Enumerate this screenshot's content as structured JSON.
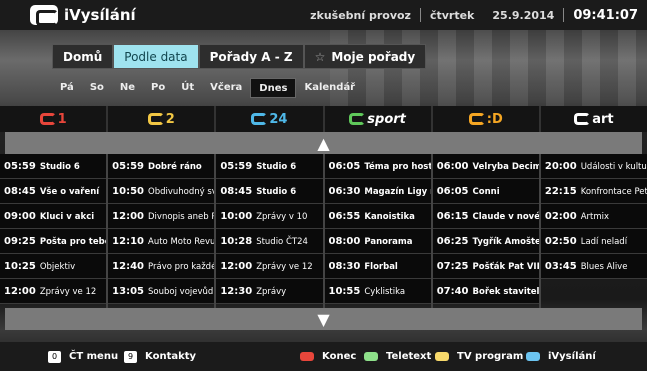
{
  "header": {
    "app_title": "iVysílání",
    "mode": "zkušební provoz",
    "weekday": "čtvrtek",
    "date": "25.9.2014",
    "time": "09:41:07"
  },
  "nav": {
    "tabs": [
      "Domů",
      "Podle data",
      "Pořady A - Z",
      "Moje pořady"
    ],
    "active_tab": "Podle data"
  },
  "days": {
    "items": [
      "Pá",
      "So",
      "Ne",
      "Po",
      "Út",
      "Včera",
      "Dnes",
      "Kalendář"
    ],
    "active": "Dnes"
  },
  "channels": [
    {
      "name": "1",
      "color": "#e8463b"
    },
    {
      "name": "2",
      "color": "#f2c744"
    },
    {
      "name": "24",
      "color": "#4fb8e8"
    },
    {
      "name": "sport",
      "color": "#5fc85a"
    },
    {
      "name": ":D",
      "color": "#f5a623"
    },
    {
      "name": "art",
      "color": "#ffffff"
    }
  ],
  "schedule": [
    [
      {
        "time": "05:59",
        "title": "Studio 6",
        "bold": true
      },
      {
        "time": "08:45",
        "title": "Vše o vaření",
        "bold": true
      },
      {
        "time": "09:00",
        "title": "Kluci v akci",
        "bold": true
      },
      {
        "time": "09:25",
        "title": "Pošta pro tebe",
        "bold": true
      },
      {
        "time": "10:25",
        "title": "Objektiv",
        "bold": false
      },
      {
        "time": "12:00",
        "title": "Zprávy ve 12",
        "bold": false
      }
    ],
    [
      {
        "time": "05:59",
        "title": "Dobré ráno",
        "bold": true
      },
      {
        "time": "10:50",
        "title": "Obdivuhodný svě",
        "bold": false
      },
      {
        "time": "12:00",
        "title": "Divnopis aneb P",
        "bold": false
      },
      {
        "time": "12:10",
        "title": "Auto Moto Revue",
        "bold": false
      },
      {
        "time": "12:40",
        "title": "Právo pro každé",
        "bold": false
      },
      {
        "time": "13:05",
        "title": "Souboj vojevůd",
        "bold": false
      }
    ],
    [
      {
        "time": "05:59",
        "title": "Studio 6",
        "bold": true
      },
      {
        "time": "08:45",
        "title": "Studio 6",
        "bold": true
      },
      {
        "time": "10:00",
        "title": "Zprávy v 10",
        "bold": false
      },
      {
        "time": "10:28",
        "title": "Studio ČT24",
        "bold": false
      },
      {
        "time": "12:00",
        "title": "Zprávy ve 12",
        "bold": false
      },
      {
        "time": "12:30",
        "title": "Zprávy",
        "bold": false
      }
    ],
    [
      {
        "time": "06:05",
        "title": "Téma pro hosty (",
        "bold": true
      },
      {
        "time": "06:30",
        "title": "Magazín Ligy mi",
        "bold": true
      },
      {
        "time": "06:55",
        "title": "Kanoistika",
        "bold": true
      },
      {
        "time": "08:00",
        "title": "Panorama",
        "bold": true
      },
      {
        "time": "08:30",
        "title": "Florbal",
        "bold": true
      },
      {
        "time": "10:55",
        "title": "Cyklistika",
        "bold": false
      }
    ],
    [
      {
        "time": "06:00",
        "title": "Velryba Decimál",
        "bold": true
      },
      {
        "time": "06:05",
        "title": "Conni",
        "bold": true
      },
      {
        "time": "06:15",
        "title": "Claude v novém m",
        "bold": true
      },
      {
        "time": "06:25",
        "title": "Tygřík Amoštek",
        "bold": true
      },
      {
        "time": "07:25",
        "title": "Pošťák Pat VIII",
        "bold": true
      },
      {
        "time": "07:40",
        "title": "Bořek stavitel",
        "bold": true
      }
    ],
    [
      {
        "time": "20:00",
        "title": "Události v kultu",
        "bold": false
      },
      {
        "time": "22:15",
        "title": "Konfrontace Pet",
        "bold": false
      },
      {
        "time": "02:00",
        "title": "Artmix",
        "bold": false
      },
      {
        "time": "02:50",
        "title": "Ladí neladí",
        "bold": false
      },
      {
        "time": "03:45",
        "title": "Blues Alive",
        "bold": false
      }
    ]
  ],
  "footer": {
    "ct_menu_key": "0",
    "ct_menu_label": "ČT menu",
    "contacts_key": "9",
    "contacts_label": "Kontakty",
    "red_label": "Konec",
    "green_label": "Teletext",
    "yellow_label": "TV program",
    "blue_label": "iVysílání",
    "colors": {
      "red": "#e8463b",
      "green": "#8ee08a",
      "yellow": "#f7d96b",
      "blue": "#6cc4f0"
    }
  },
  "icons": {
    "scroll_up": "▲",
    "scroll_down": "▼",
    "star": "☆"
  }
}
